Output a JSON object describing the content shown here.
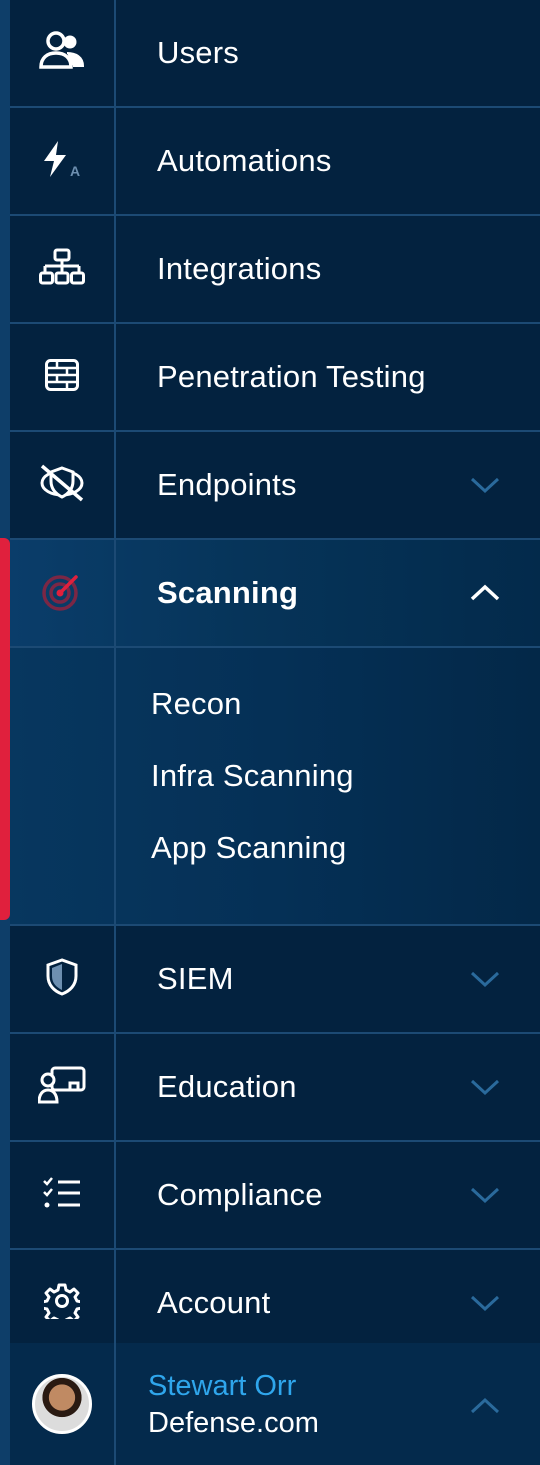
{
  "nav": {
    "items": [
      {
        "label": "Users",
        "icon": "users-icon"
      },
      {
        "label": "Automations",
        "icon": "automation-bolt-icon"
      },
      {
        "label": "Integrations",
        "icon": "network-hierarchy-icon"
      },
      {
        "label": "Penetration Testing",
        "icon": "firewall-brick-icon"
      },
      {
        "label": "Endpoints",
        "icon": "endpoint-shield-icon",
        "expandable": true,
        "expanded": false
      },
      {
        "label": "Scanning",
        "icon": "radar-scan-icon",
        "expandable": true,
        "expanded": true,
        "active": true
      },
      {
        "label": "SIEM",
        "icon": "shield-icon",
        "expandable": true,
        "expanded": false
      },
      {
        "label": "Education",
        "icon": "education-presenter-icon",
        "expandable": true,
        "expanded": false
      },
      {
        "label": "Compliance",
        "icon": "checklist-icon",
        "expandable": true,
        "expanded": false
      },
      {
        "label": "Account",
        "icon": "gear-icon",
        "expandable": true,
        "expanded": false
      }
    ],
    "scanning_subitems": [
      "Recon",
      "Infra Scanning",
      "App Scanning"
    ]
  },
  "user": {
    "name": "Stewart Orr",
    "company": "Defense.com"
  },
  "colors": {
    "background": "#02223f",
    "divider": "#1c4a74",
    "active_accent": "#e0203d",
    "user_name": "#2fa6ec",
    "chevron_collapsed": "#2a6a9c"
  }
}
